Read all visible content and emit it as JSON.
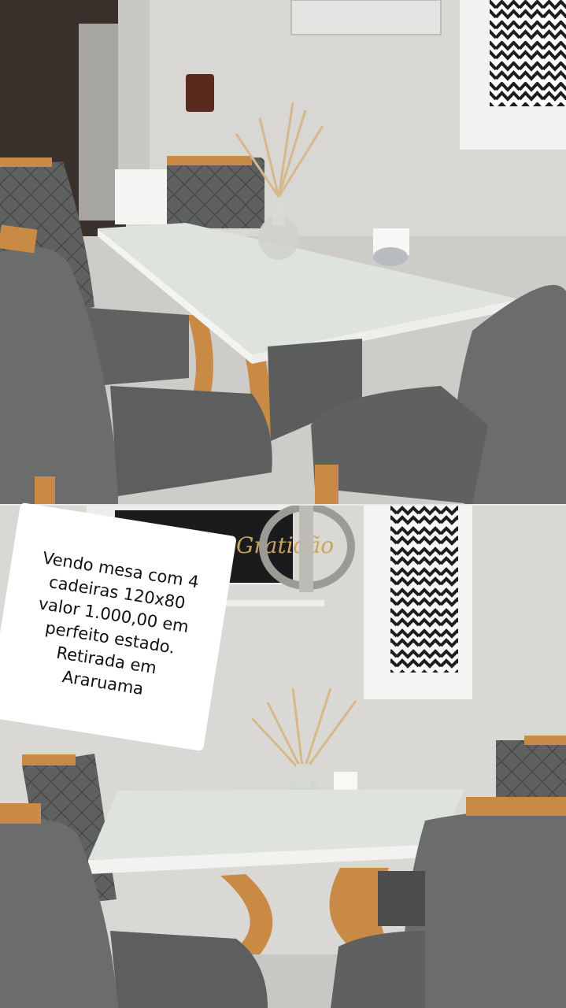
{
  "photos": [
    {
      "name": "dining-set-photo-angle-1"
    },
    {
      "name": "dining-set-photo-angle-2"
    }
  ],
  "caption": {
    "lines": [
      "Vendo mesa com 4",
      "cadeiras 120x80",
      "valor 1.000,00 em",
      "perfeito estado.",
      "Retirada em",
      "Araruama"
    ]
  },
  "decor": {
    "wall_sign_text": "Gratidão",
    "colors": {
      "chair_fabric": "#6a6d6c",
      "wood": "#c98a45",
      "glass": "#dfe3de",
      "wall": "#d8d7d4",
      "zigzag": "#1d1d1d"
    }
  }
}
